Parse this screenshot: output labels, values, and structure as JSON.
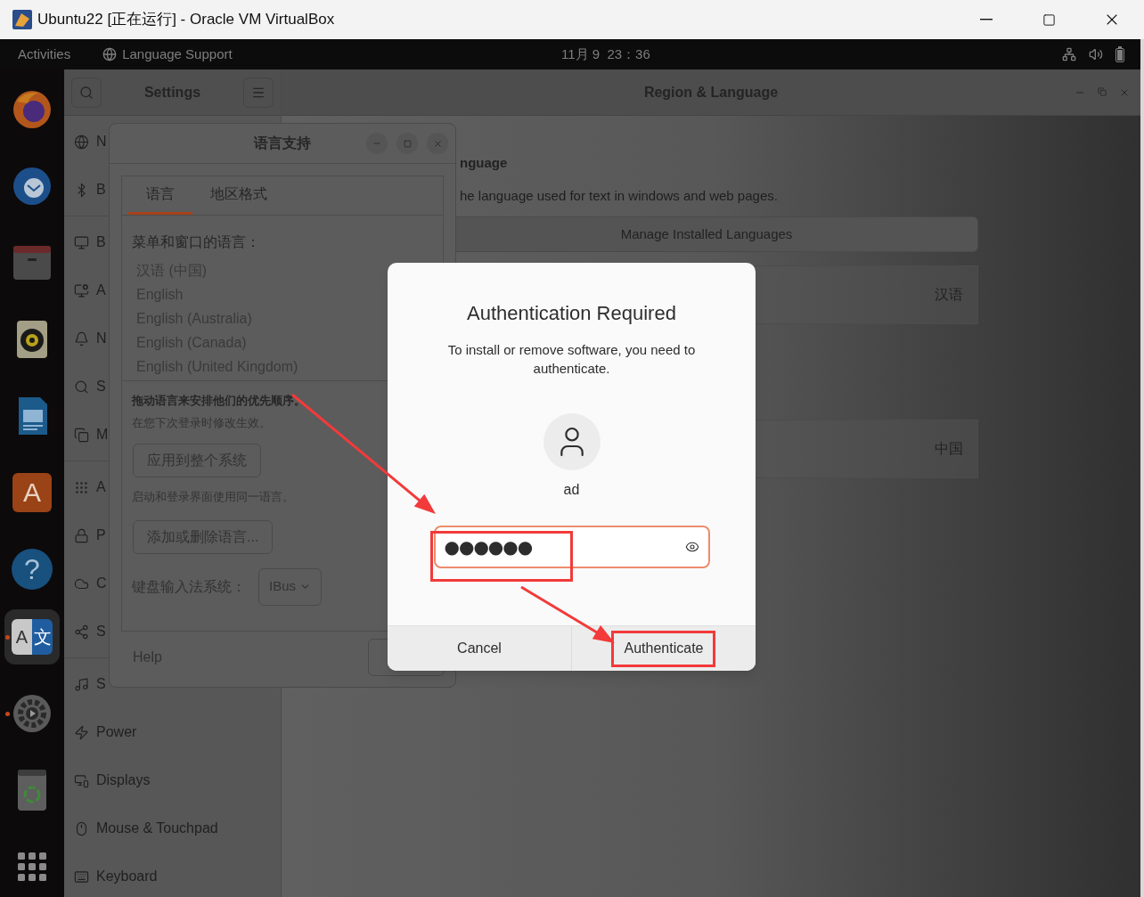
{
  "host_window": {
    "title": "Ubuntu22 [正在运行] - Oracle VM VirtualBox"
  },
  "top_bar": {
    "activities": "Activities",
    "app_menu": "Language Support",
    "clock": "11月 9  23：36"
  },
  "dock": {
    "apps": [
      {
        "kind": "browser",
        "running": false,
        "selected": false
      },
      {
        "kind": "mail",
        "running": false,
        "selected": false
      },
      {
        "kind": "folder",
        "running": false,
        "selected": false
      },
      {
        "kind": "speaker",
        "running": false,
        "selected": false
      },
      {
        "kind": "document",
        "running": false,
        "selected": false
      },
      {
        "kind": "store",
        "running": false,
        "selected": false,
        "glyphs": [
          "A"
        ]
      },
      {
        "kind": "help",
        "running": false,
        "selected": false,
        "glyphs": [
          "?"
        ]
      },
      {
        "kind": "language",
        "running": true,
        "selected": true,
        "glyphs": [
          "A",
          "文"
        ]
      },
      {
        "kind": "gear",
        "running": true,
        "selected": false
      },
      {
        "kind": "trash",
        "running": false,
        "selected": false
      }
    ]
  },
  "settings": {
    "title": "Settings",
    "panel_title": "Region & Language",
    "sidebar_groups": [
      {
        "items": [
          {
            "kind": "globe",
            "label": "N"
          },
          {
            "kind": "bluetooth",
            "label": "B"
          }
        ]
      },
      {
        "items": [
          {
            "kind": "background",
            "label": "B"
          },
          {
            "kind": "appearance",
            "label": "A"
          },
          {
            "kind": "bell",
            "label": "N"
          },
          {
            "kind": "search",
            "label": "S"
          },
          {
            "kind": "multitasking",
            "label": "M"
          }
        ]
      },
      {
        "items": [
          {
            "kind": "apps",
            "label": "A"
          },
          {
            "kind": "lock",
            "label": "P"
          },
          {
            "kind": "cloud",
            "label": "C"
          },
          {
            "kind": "share",
            "label": "S"
          }
        ]
      },
      {
        "items": [
          {
            "kind": "music",
            "label": "S"
          },
          {
            "kind": "power",
            "label": "Power"
          },
          {
            "kind": "displays",
            "label": "Displays"
          },
          {
            "kind": "mouse",
            "label": "Mouse & Touchpad"
          },
          {
            "kind": "keyboard",
            "label": "Keyboard"
          }
        ]
      }
    ],
    "section_title": "nguage",
    "section_description": "he language used for text in windows and web pages.",
    "manage_button": "Manage Installed Languages",
    "rows": [
      {
        "value": "汉语"
      },
      {
        "value": "中国"
      }
    ]
  },
  "language_dialog": {
    "title": "语言支持",
    "tabs": [
      {
        "label": "语言",
        "selected": true
      },
      {
        "label": "地区格式",
        "selected": false
      }
    ],
    "list_label": "菜单和窗口的语言：",
    "languages": [
      "汉语 (中国)",
      "English",
      "English (Australia)",
      "English (Canada)",
      "English (United Kingdom)"
    ],
    "hint_bold": "拖动语言来安排他们的优先顺序。",
    "hint": "在您下次登录时修改生效。",
    "apply_button": "应用到整个系统",
    "apply_hint": "启动和登录界面使用同一语言。",
    "add_remove_button": "添加或删除语言...",
    "input_label": "键盘输入法系统：",
    "input_method": "IBus",
    "help": "Help"
  },
  "auth_dialog": {
    "title": "Authentication Required",
    "message": "To install or remove software, you need to authenticate.",
    "user": "ad",
    "password": "●●●●●●",
    "buttons": [
      {
        "label": "Cancel",
        "highlighted": false
      },
      {
        "label": "Authenticate",
        "highlighted": true
      }
    ]
  }
}
